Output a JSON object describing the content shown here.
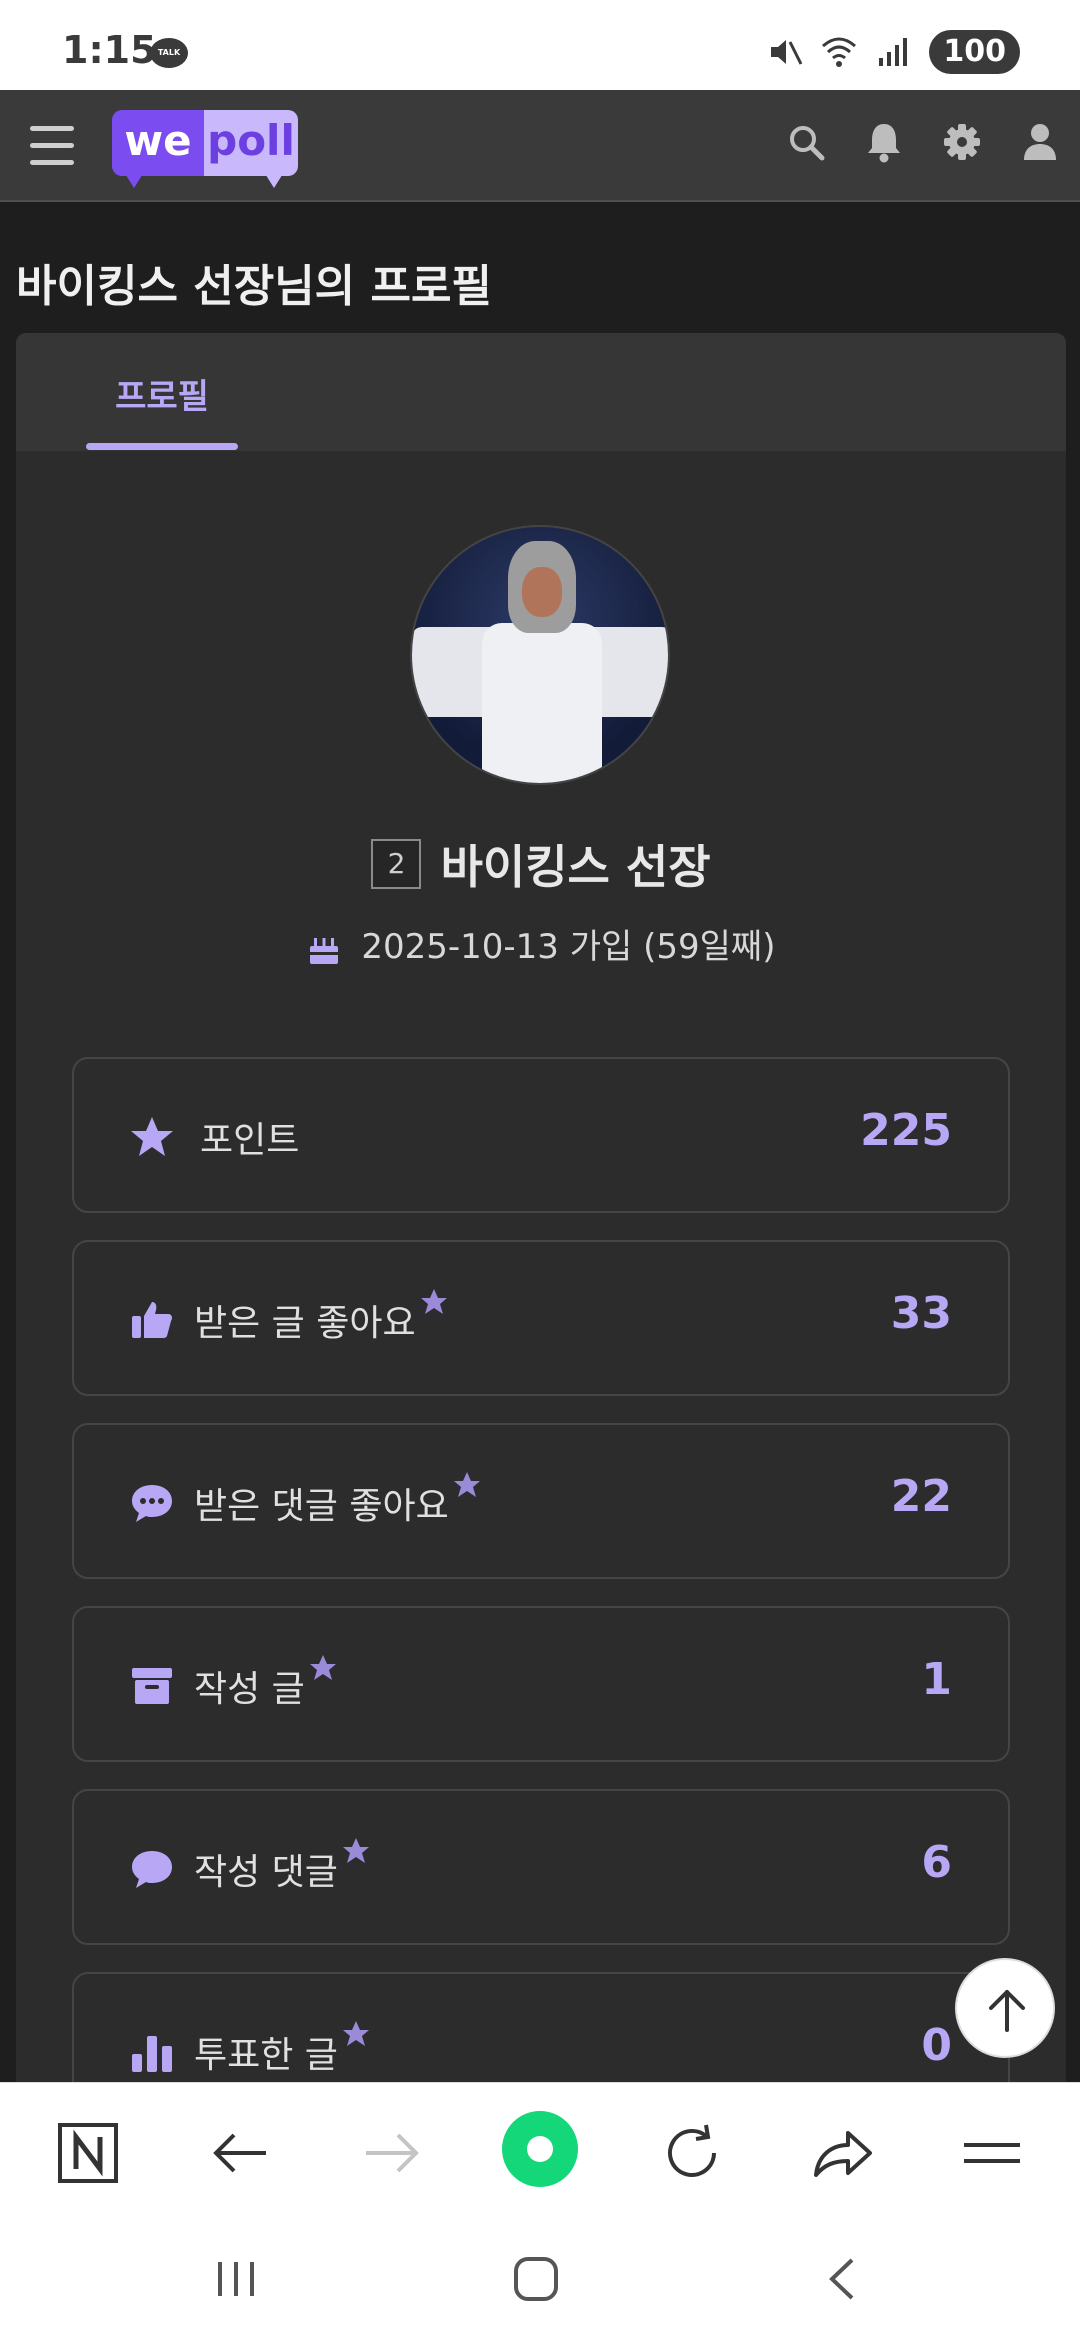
{
  "status_bar": {
    "time": "1:15",
    "talk_badge": "TALK",
    "battery": "100"
  },
  "header": {
    "logo_we": "we",
    "logo_poll": "poll",
    "accent_color": "#7b4cf0"
  },
  "page": {
    "title": "바이킹스 선장님의 프로필"
  },
  "tabs": [
    {
      "label": "프로필",
      "active": true
    }
  ],
  "profile": {
    "level": "2",
    "username": "바이킹스 선장",
    "join_text": "2025-10-13 가입 (59일째)"
  },
  "stats": [
    {
      "icon": "star-icon",
      "label": "포인트",
      "value": "225",
      "starred": false
    },
    {
      "icon": "thumbs-up-icon",
      "label": "받은 글 좋아요",
      "value": "33",
      "starred": true
    },
    {
      "icon": "comment-dots-icon",
      "label": "받은 댓글 좋아요",
      "value": "22",
      "starred": true
    },
    {
      "icon": "archive-box-icon",
      "label": "작성 글",
      "value": "1",
      "starred": true
    },
    {
      "icon": "speech-bubble-icon",
      "label": "작성 댓글",
      "value": "6",
      "starred": true
    },
    {
      "icon": "bar-chart-icon",
      "label": "투표한 글",
      "value": "0",
      "starred": true
    }
  ]
}
